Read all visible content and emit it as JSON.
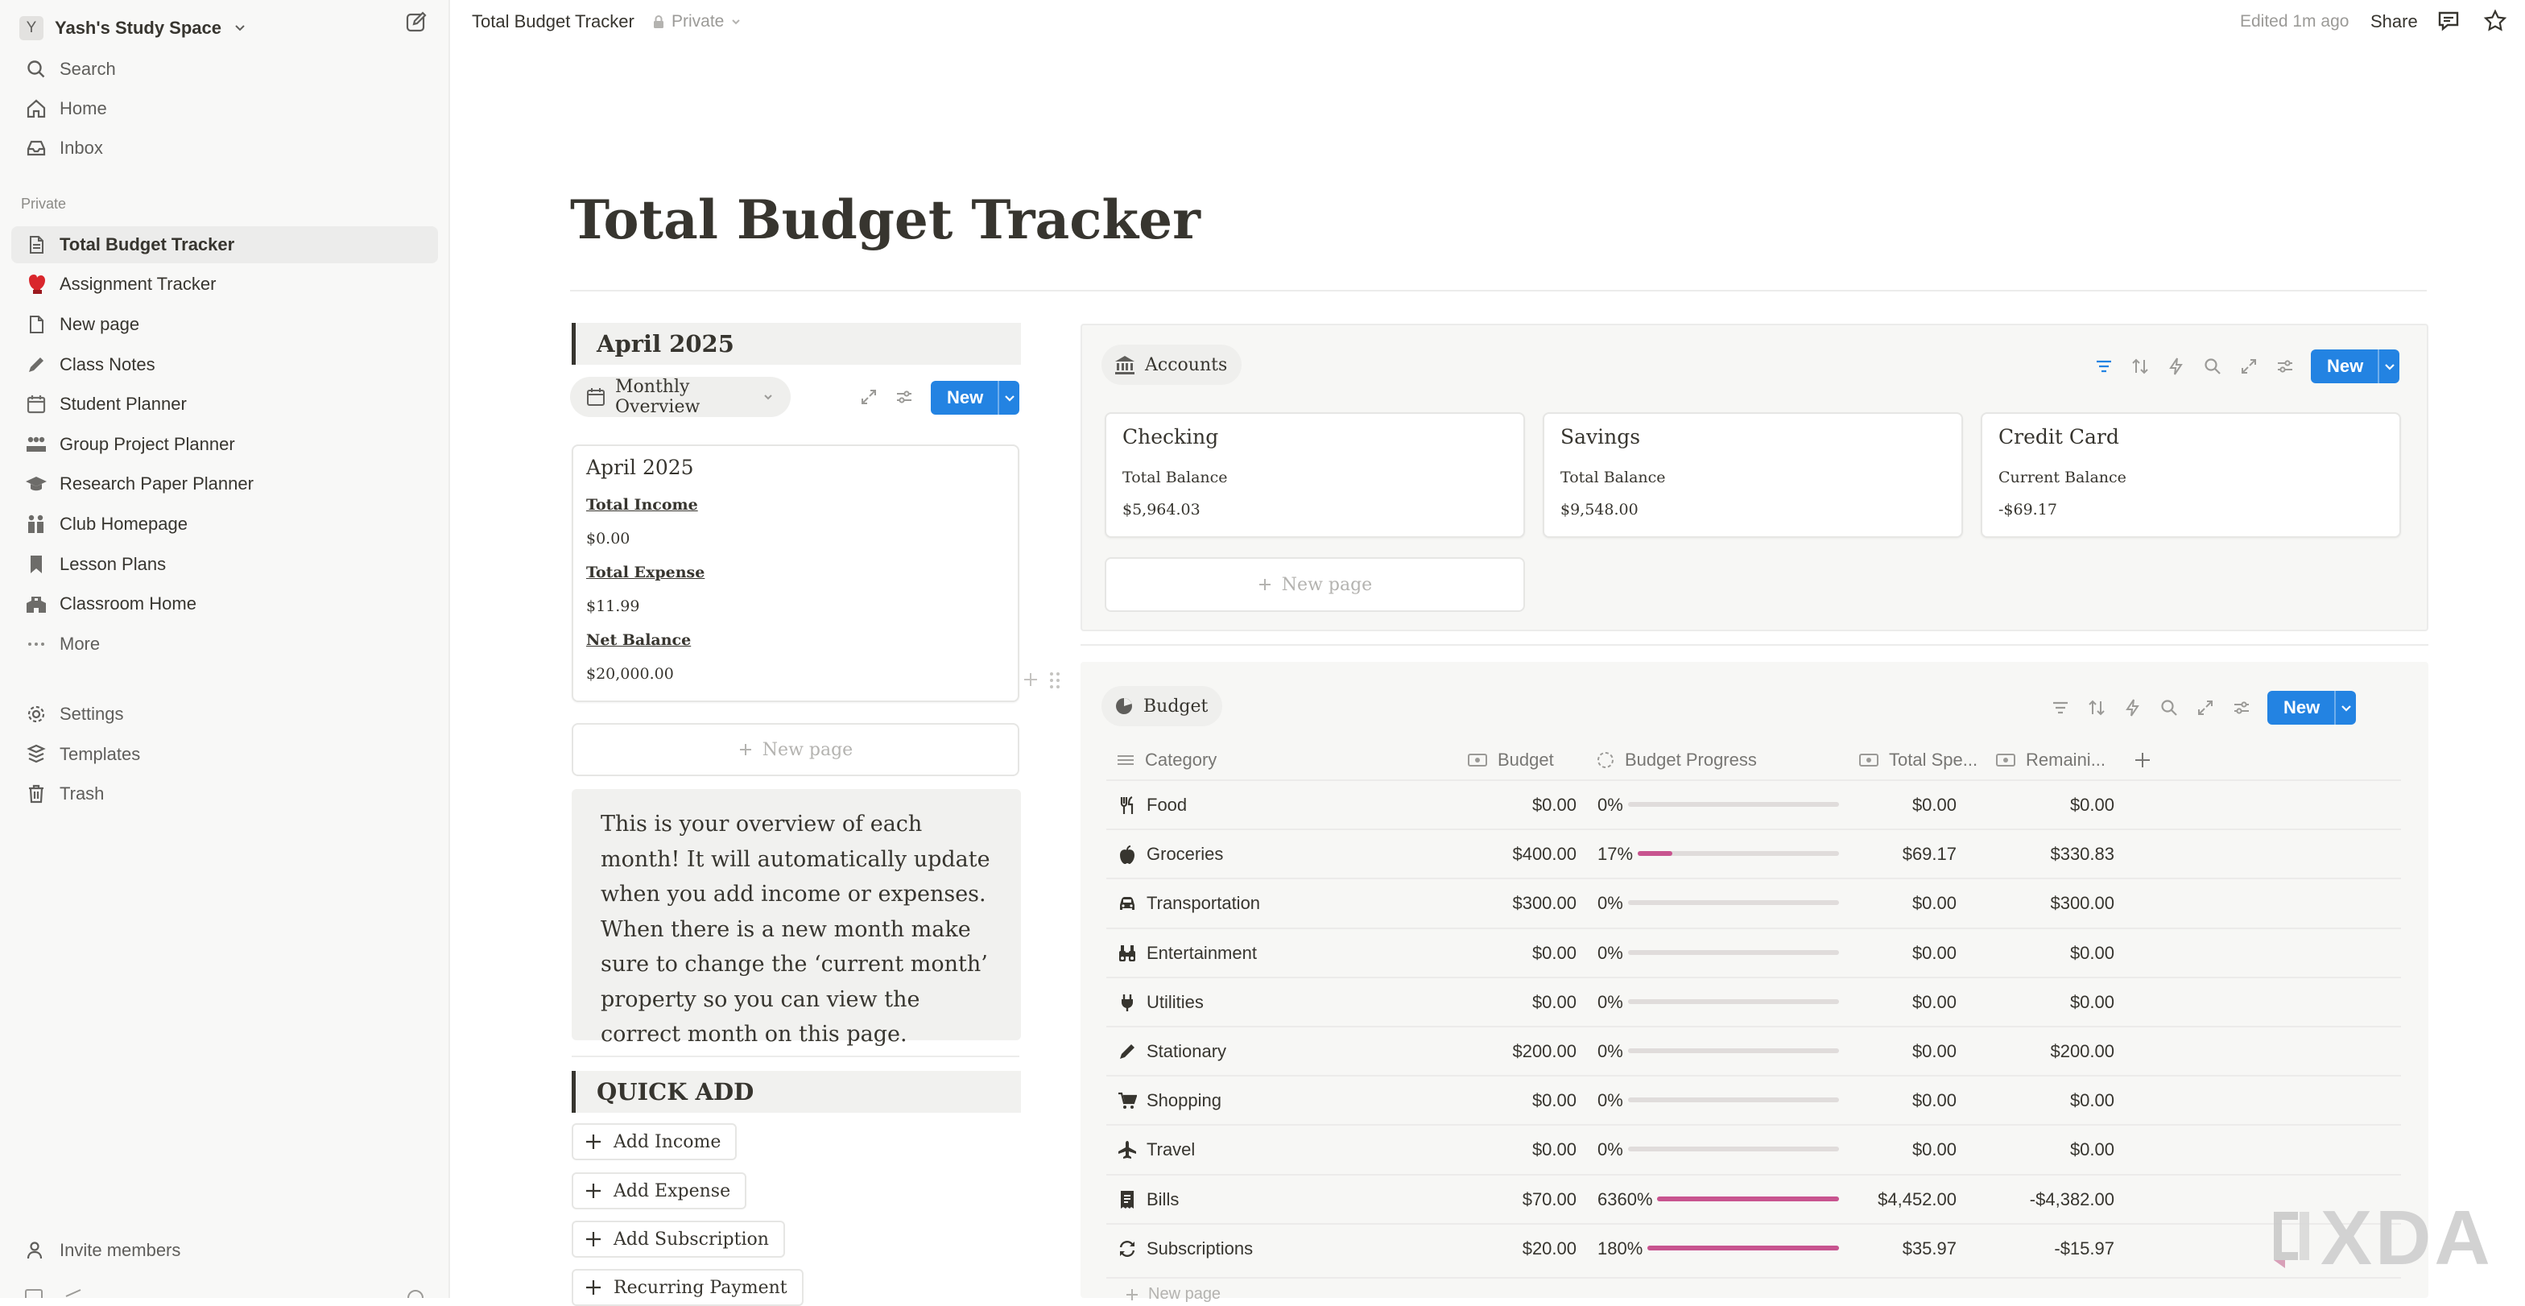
{
  "sidebar": {
    "workspace": {
      "avatar": "Y",
      "name": "Yash's Study Space"
    },
    "top_nav": [
      {
        "label": "Search",
        "icon": "search-icon"
      },
      {
        "label": "Home",
        "icon": "home-icon"
      },
      {
        "label": "Inbox",
        "icon": "inbox-icon"
      }
    ],
    "section_label": "Private",
    "pages": [
      {
        "label": "Total Budget Tracker",
        "icon": "page-icon",
        "active": true
      },
      {
        "label": "Assignment Tracker",
        "icon": "boxing-glove-icon"
      },
      {
        "label": "New page",
        "icon": "page-icon"
      },
      {
        "label": "Class Notes",
        "icon": "pencil-icon"
      },
      {
        "label": "Student Planner",
        "icon": "calendar-icon"
      },
      {
        "label": "Group Project Planner",
        "icon": "people-icon"
      },
      {
        "label": "Research Paper Planner",
        "icon": "graduation-cap-icon"
      },
      {
        "label": "Club Homepage",
        "icon": "group-icon"
      },
      {
        "label": "Lesson Plans",
        "icon": "bookmark-icon"
      },
      {
        "label": "Classroom Home",
        "icon": "school-icon"
      },
      {
        "label": "More",
        "icon": "ellipsis-icon"
      }
    ],
    "bottom_nav": [
      {
        "label": "Settings",
        "icon": "gear-icon"
      },
      {
        "label": "Templates",
        "icon": "templates-icon"
      },
      {
        "label": "Trash",
        "icon": "trash-icon"
      }
    ],
    "invite": "Invite members"
  },
  "topbar": {
    "page_title": "Total Budget Tracker",
    "privacy": "Private",
    "edited": "Edited 1m ago",
    "share": "Share"
  },
  "page": {
    "title": "Total Budget Tracker",
    "month_heading": "April 2025",
    "monthly_view": {
      "label": "Monthly Overview",
      "new_label": "New"
    },
    "month_card": {
      "title": "April 2025",
      "fields": [
        {
          "label": "Total Income",
          "value": "$0.00"
        },
        {
          "label": "Total Expense",
          "value": "$11.99"
        },
        {
          "label": "Net Balance",
          "value": "$20,000.00"
        }
      ]
    },
    "new_page_label": "New page",
    "note": "This is your overview of each month! It will automatically update when you add income or expenses. When there is a new month make sure to change the ‘current month’ property so you can view the correct month on this page.",
    "quick_add": {
      "heading": "QUICK ADD",
      "buttons": [
        "Add Income",
        "Add Expense",
        "Add Subscription",
        "Recurring Payment"
      ]
    },
    "accounts": {
      "label": "Accounts",
      "new_label": "New",
      "cards": [
        {
          "name": "Checking",
          "field": "Total Balance",
          "value": "$5,964.03"
        },
        {
          "name": "Savings",
          "field": "Total Balance",
          "value": "$9,548.00"
        },
        {
          "name": "Credit Card",
          "field": "Current Balance",
          "value": "-$69.17"
        }
      ],
      "new_page_label": "New page"
    },
    "budget": {
      "label": "Budget",
      "new_label": "New",
      "columns": [
        "Category",
        "Budget",
        "Budget Progress",
        "Total Spe...",
        "Remaini..."
      ],
      "progress_color": "#c8548f",
      "rows": [
        {
          "category": "Food",
          "icon": "utensils-icon",
          "budget": "$0.00",
          "progress_label": "0%",
          "progress": 0,
          "spent": "$0.00",
          "remaining": "$0.00"
        },
        {
          "category": "Groceries",
          "icon": "apple-icon",
          "budget": "$400.00",
          "progress_label": "17%",
          "progress": 0.17,
          "spent": "$69.17",
          "remaining": "$330.83"
        },
        {
          "category": "Transportation",
          "icon": "car-icon",
          "budget": "$300.00",
          "progress_label": "0%",
          "progress": 0,
          "spent": "$0.00",
          "remaining": "$300.00"
        },
        {
          "category": "Entertainment",
          "icon": "binoculars-icon",
          "budget": "$0.00",
          "progress_label": "0%",
          "progress": 0,
          "spent": "$0.00",
          "remaining": "$0.00"
        },
        {
          "category": "Utilities",
          "icon": "plug-icon",
          "budget": "$0.00",
          "progress_label": "0%",
          "progress": 0,
          "spent": "$0.00",
          "remaining": "$0.00"
        },
        {
          "category": "Stationary",
          "icon": "pencil-icon",
          "budget": "$200.00",
          "progress_label": "0%",
          "progress": 0,
          "spent": "$0.00",
          "remaining": "$200.00"
        },
        {
          "category": "Shopping",
          "icon": "cart-icon",
          "budget": "$0.00",
          "progress_label": "0%",
          "progress": 0,
          "spent": "$0.00",
          "remaining": "$0.00"
        },
        {
          "category": "Travel",
          "icon": "airplane-icon",
          "budget": "$0.00",
          "progress_label": "0%",
          "progress": 0,
          "spent": "$0.00",
          "remaining": "$0.00"
        },
        {
          "category": "Bills",
          "icon": "receipt-icon",
          "budget": "$70.00",
          "progress_label": "6360%",
          "progress": 1,
          "spent": "$4,452.00",
          "remaining": "-$4,382.00"
        },
        {
          "category": "Subscriptions",
          "icon": "refresh-icon",
          "budget": "$20.00",
          "progress_label": "180%",
          "progress": 1,
          "spent": "$35.97",
          "remaining": "-$15.97"
        }
      ],
      "new_page_label": "New page"
    }
  },
  "watermark": "XDA"
}
